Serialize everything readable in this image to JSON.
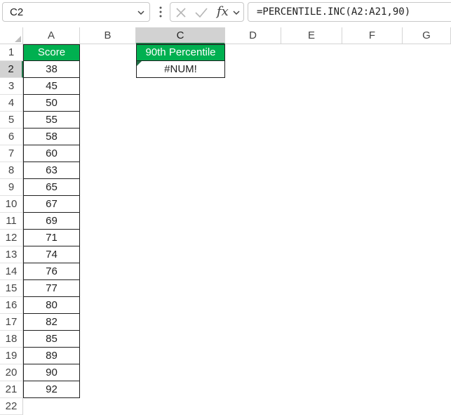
{
  "formula_bar": {
    "name_box": "C2",
    "fx_label": "fx",
    "formula": "=PERCENTILE.INC(A2:A21,90)"
  },
  "columns": [
    "A",
    "B",
    "C",
    "D",
    "E",
    "F",
    "G"
  ],
  "selected_column": "C",
  "rows": [
    "1",
    "2",
    "3",
    "4",
    "5",
    "6",
    "7",
    "8",
    "9",
    "10",
    "11",
    "12",
    "13",
    "14",
    "15",
    "16",
    "17",
    "18",
    "19",
    "20",
    "21",
    "22"
  ],
  "selected_row": "2",
  "score_header": "Score",
  "scores": [
    "38",
    "45",
    "50",
    "55",
    "58",
    "60",
    "63",
    "65",
    "67",
    "69",
    "71",
    "74",
    "76",
    "77",
    "80",
    "82",
    "85",
    "89",
    "90",
    "92"
  ],
  "result_header": "90th Percentile",
  "result_value": "#NUM!",
  "colors": {
    "header_fill": "#00b050",
    "header_text": "#ffffff",
    "selection_accent": "#1e7145"
  }
}
